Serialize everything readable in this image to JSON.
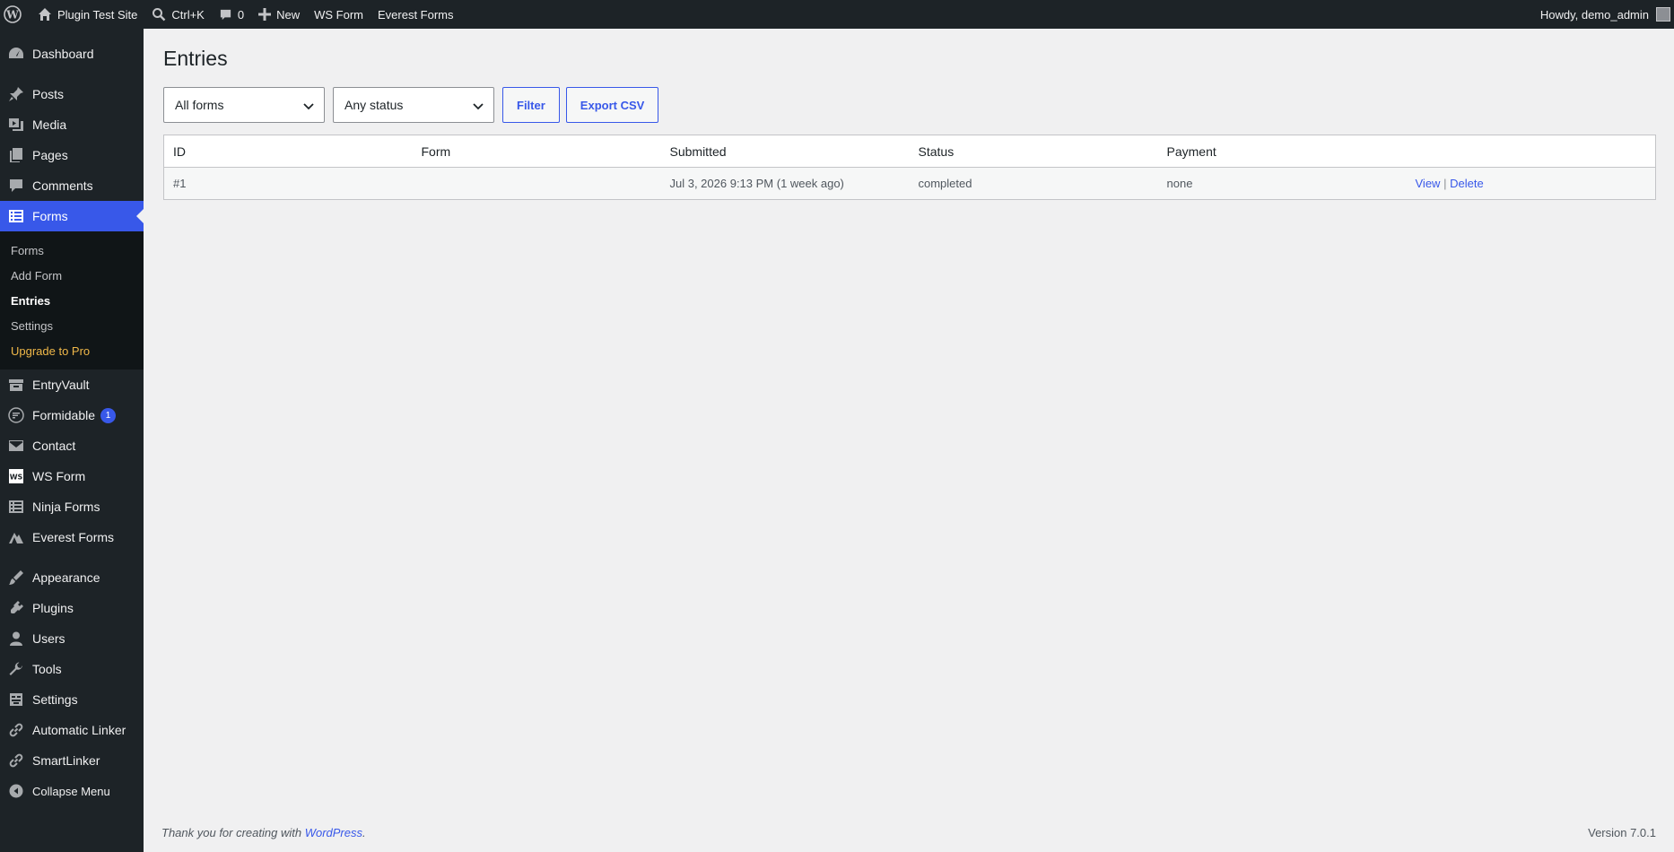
{
  "adminbar": {
    "site_name": "Plugin Test Site",
    "search_shortcut": "Ctrl+K",
    "comments_count": "0",
    "new_label": "New",
    "ws_form": "WS Form",
    "everest_forms": "Everest Forms",
    "howdy": "Howdy, demo_admin"
  },
  "sidebar": {
    "dashboard": "Dashboard",
    "posts": "Posts",
    "media": "Media",
    "pages": "Pages",
    "comments": "Comments",
    "forms": "Forms",
    "submenu": {
      "forms": "Forms",
      "add_form": "Add Form",
      "entries": "Entries",
      "settings": "Settings",
      "upgrade": "Upgrade to Pro"
    },
    "entryvault": "EntryVault",
    "formidable": "Formidable",
    "formidable_badge": "1",
    "contact": "Contact",
    "ws_form": "WS Form",
    "ninja_forms": "Ninja Forms",
    "everest_forms": "Everest Forms",
    "appearance": "Appearance",
    "plugins": "Plugins",
    "users": "Users",
    "tools": "Tools",
    "settings": "Settings",
    "automatic_linker": "Automatic Linker",
    "smartlinker": "SmartLinker",
    "collapse": "Collapse Menu"
  },
  "main": {
    "title": "Entries",
    "form_select": "All forms",
    "status_select": "Any status",
    "filter_button": "Filter",
    "export_button": "Export CSV",
    "table": {
      "headers": [
        "ID",
        "Form",
        "Submitted",
        "Status",
        "Payment",
        ""
      ],
      "rows": [
        {
          "id": "#1",
          "form": "",
          "submitted": "Jul 3, 2026 9:13 PM (1 week ago)",
          "status": "completed",
          "payment": "none",
          "view": "View",
          "separator": "|",
          "delete": "Delete"
        }
      ]
    }
  },
  "footer": {
    "thanks_prefix": "Thank you for creating with",
    "wordpress": "WordPress",
    "period": ".",
    "version": "Version 7.0.1"
  }
}
